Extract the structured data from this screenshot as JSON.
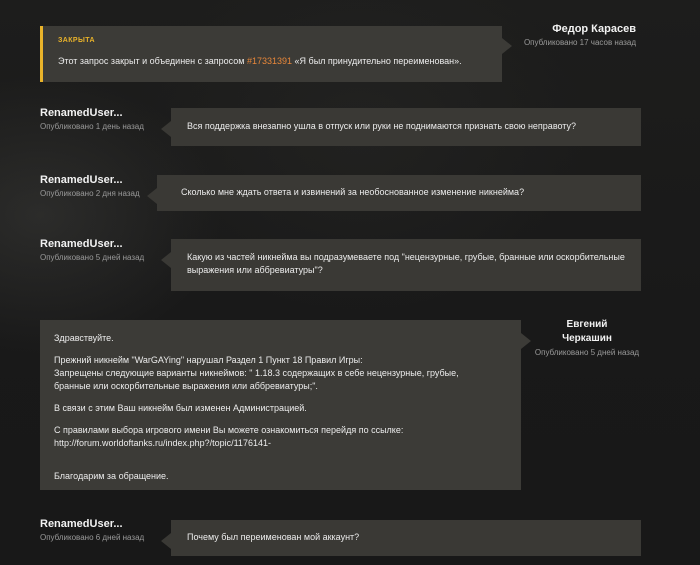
{
  "closed_notice": {
    "label": "ЗАКРЫТА",
    "text_before": "Этот запрос закрыт и объединен с запросом ",
    "link": "#17331391",
    "text_after": " «Я был принудительно переименован».",
    "author": "Федор Карасев",
    "time": "Опубликовано 17 часов назад"
  },
  "messages": [
    {
      "author": "RenamedUser...",
      "time": "Опубликовано 1 день назад",
      "text": "Вся поддержка внезапно ушла в отпуск или руки не поднимаются признать свою неправоту?"
    },
    {
      "author": "RenamedUser...",
      "time": "Опубликовано 2 дня назад",
      "text": "Сколько мне ждать ответа и извинений за необоснованное изменение никнейма?"
    },
    {
      "author": "RenamedUser...",
      "time": "Опубликовано 5 дней назад",
      "text": "Какую из частей никнейма вы подразумеваете под \"нецензурные, грубые, бранные или оскорбительные\nвыражения или аббревиатуры\"?"
    }
  ],
  "staff_reply": {
    "author_first": "Евгений",
    "author_last": "Черкашин",
    "time": "Опубликовано 5 дней назад",
    "greeting": "Здравствуйте.",
    "paragraph1": "Прежний никнейм \"WarGAYing\" нарушал Раздел 1 Пункт 18 Правил Игры:\nЗапрещены следующие варианты никнеймов: \" 1.18.3 содержащих в себе нецензурные, грубые,\nбранные или оскорбительные выражения или аббревиатуры;\".",
    "paragraph2": "В связи с этим Ваш никнейм был изменен Администрацией.",
    "paragraph3": "С правилами выбора игрового имени Вы можете ознакомиться перейдя по ссылке:\nhttp://forum.worldoftanks.ru/index.php?/topic/1176141-",
    "closing": "Благодарим за обращение."
  },
  "last_message": {
    "author": "RenamedUser...",
    "time": "Опубликовано 6 дней назад",
    "text": "Почему был переименован мой аккаунт?"
  }
}
